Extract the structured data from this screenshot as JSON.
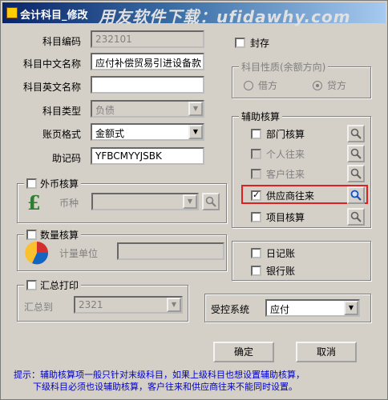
{
  "window": {
    "title": "会计科目_修改",
    "watermark": "用友软件下载：ufidawhy.com"
  },
  "subject": {
    "code_label": "科目编码",
    "code_value": "232101",
    "cn_name_label": "科目中文名称",
    "cn_name_value": "应付补偿贸易引进设备款",
    "en_name_label": "科目英文名称",
    "en_name_value": "",
    "type_label": "科目类型",
    "type_value": "负债",
    "format_label": "账页格式",
    "format_value": "金额式",
    "mnemonic_label": "助记码",
    "mnemonic_value": "YFBCMYYJSBK"
  },
  "sealed": {
    "label": "封存"
  },
  "nature": {
    "title": "科目性质(余额方向)",
    "debit": "借方",
    "credit": "贷方"
  },
  "foreign": {
    "title": "外币核算",
    "currency_label": "币种"
  },
  "quantity": {
    "title": "数量核算",
    "unit_label": "计量单位"
  },
  "summary": {
    "title": "汇总打印",
    "to_label": "汇总到",
    "to_value": "2321"
  },
  "aux": {
    "title": "辅助核算",
    "items": [
      {
        "label": "部门核算",
        "checked": false,
        "enabled": true
      },
      {
        "label": "个人往来",
        "checked": false,
        "enabled": false
      },
      {
        "label": "客户往来",
        "checked": false,
        "enabled": false
      },
      {
        "label": "供应商往来",
        "checked": true,
        "enabled": true
      },
      {
        "label": "项目核算",
        "checked": false,
        "enabled": true
      }
    ]
  },
  "journal": {
    "daily_label": "日记账",
    "bank_label": "银行账"
  },
  "control": {
    "label": "受控系统",
    "value": "应付"
  },
  "buttons": {
    "ok": "确定",
    "cancel": "取消"
  },
  "hint": {
    "line1": "提示：辅助核算项一般只针对末级科目，如果上级科目也想设置辅助核算，",
    "line2": "下级科目必须也设辅助核算，客户往来和供应商往来不能同时设置。"
  },
  "colors": {
    "title_bar": "#0a246a",
    "highlight_box": "#e02020",
    "hint_text": "#0000cc"
  }
}
